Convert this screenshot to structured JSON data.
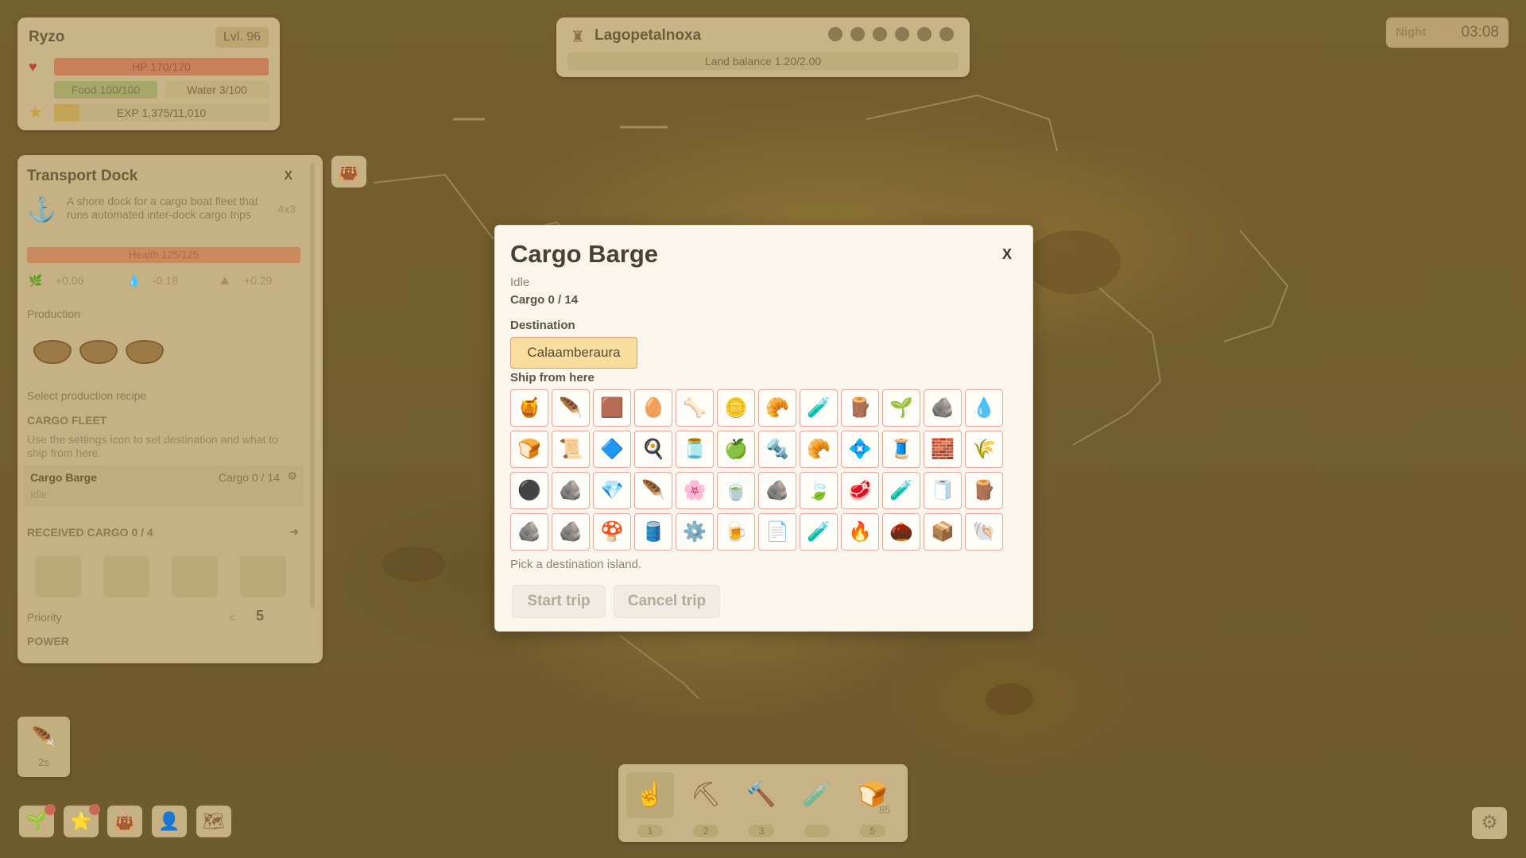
{
  "player": {
    "name": "Ryzo",
    "level": "Lvl. 96",
    "hp": "HP 170/170",
    "food": "Food 100/100",
    "water": "Water 3/100",
    "exp": "EXP 1,375/11,010",
    "exp_fraction": 0.12
  },
  "land": {
    "name": "Lagopetalnoxa",
    "balance": "Land balance 1.20/2.00",
    "balance_fraction": 0.6
  },
  "time": {
    "phase": "Night",
    "clock": "03:08"
  },
  "dock": {
    "title": "Transport Dock",
    "close": "X",
    "description": "A shore dock for a cargo boat fleet that runs automated inter-dock cargo trips",
    "size": "4x3",
    "health": "Health 125/125",
    "stats": [
      "+0.06",
      "-0.18",
      "+0.29"
    ],
    "production_label": "Production",
    "select_recipe": "Select production recipe",
    "fleet_label": "CARGO FLEET",
    "fleet_hint": "Use the settings icon to set destination and what to ship from here.",
    "barge_name": "Cargo Barge",
    "barge_cargo": "Cargo 0 / 14",
    "barge_status": "Idle",
    "received": "RECEIVED CARGO  0 / 4",
    "priority_label": "Priority",
    "priority_value": "5",
    "priority_arrow": "<",
    "power_label": "POWER"
  },
  "craft": {
    "timer": "2s"
  },
  "toolbar": {
    "keys": [
      "1",
      "2",
      "3",
      "",
      "5"
    ],
    "count": "85"
  },
  "modal": {
    "title": "Cargo Barge",
    "close": "X",
    "status": "Idle",
    "cargo": "Cargo 0 / 14",
    "destination_label": "Destination",
    "destination": "Calaamberaura",
    "ship_label": "Ship from here",
    "hint": "Pick a destination island.",
    "start": "Start trip",
    "cancel": "Cancel trip",
    "items": [
      {
        "icon": "🍯",
        "name": "honeycomb"
      },
      {
        "icon": "🪶",
        "name": "feather"
      },
      {
        "icon": "🟫",
        "name": "soil"
      },
      {
        "icon": "🥚",
        "name": "egg"
      },
      {
        "icon": "🦴",
        "name": "bone"
      },
      {
        "icon": "🪙",
        "name": "coin"
      },
      {
        "icon": "🥐",
        "name": "croissant"
      },
      {
        "icon": "🧪",
        "name": "potion-red"
      },
      {
        "icon": "🪵",
        "name": "plank"
      },
      {
        "icon": "🌱",
        "name": "sapling"
      },
      {
        "icon": "🪨",
        "name": "stone"
      },
      {
        "icon": "💧",
        "name": "water-drop"
      },
      {
        "icon": "🍞",
        "name": "bread"
      },
      {
        "icon": "📜",
        "name": "scroll"
      },
      {
        "icon": "🔷",
        "name": "crystal-blue"
      },
      {
        "icon": "🍳",
        "name": "fried-egg"
      },
      {
        "icon": "🫙",
        "name": "jar"
      },
      {
        "icon": "🍏",
        "name": "apple"
      },
      {
        "icon": "🔩",
        "name": "iron-ingot"
      },
      {
        "icon": "🥐",
        "name": "pastry"
      },
      {
        "icon": "💠",
        "name": "ice-crystal"
      },
      {
        "icon": "🧵",
        "name": "rope"
      },
      {
        "icon": "🧱",
        "name": "stone-block"
      },
      {
        "icon": "🌾",
        "name": "wheat"
      },
      {
        "icon": "⚫",
        "name": "coal-ball"
      },
      {
        "icon": "🪨",
        "name": "coal-ore"
      },
      {
        "icon": "💎",
        "name": "diamond"
      },
      {
        "icon": "🪶",
        "name": "quill"
      },
      {
        "icon": "🌸",
        "name": "flower"
      },
      {
        "icon": "🍵",
        "name": "tea"
      },
      {
        "icon": "🪨",
        "name": "ore"
      },
      {
        "icon": "🍃",
        "name": "leaf"
      },
      {
        "icon": "🥩",
        "name": "meat"
      },
      {
        "icon": "🧪",
        "name": "potion-small"
      },
      {
        "icon": "🧻",
        "name": "spool"
      },
      {
        "icon": "🪵",
        "name": "log"
      },
      {
        "icon": "🪨",
        "name": "coal-pile"
      },
      {
        "icon": "🪨",
        "name": "charcoal"
      },
      {
        "icon": "🍄",
        "name": "mushroom"
      },
      {
        "icon": "🛢️",
        "name": "barrel"
      },
      {
        "icon": "⚙️",
        "name": "gear"
      },
      {
        "icon": "🍺",
        "name": "honey-jar"
      },
      {
        "icon": "📄",
        "name": "metal-sheet"
      },
      {
        "icon": "🧪",
        "name": "potion-large"
      },
      {
        "icon": "🔥",
        "name": "fire-drop"
      },
      {
        "icon": "🌰",
        "name": "seed-pile"
      },
      {
        "icon": "📦",
        "name": "crates"
      },
      {
        "icon": "🐚",
        "name": "shell"
      }
    ]
  }
}
